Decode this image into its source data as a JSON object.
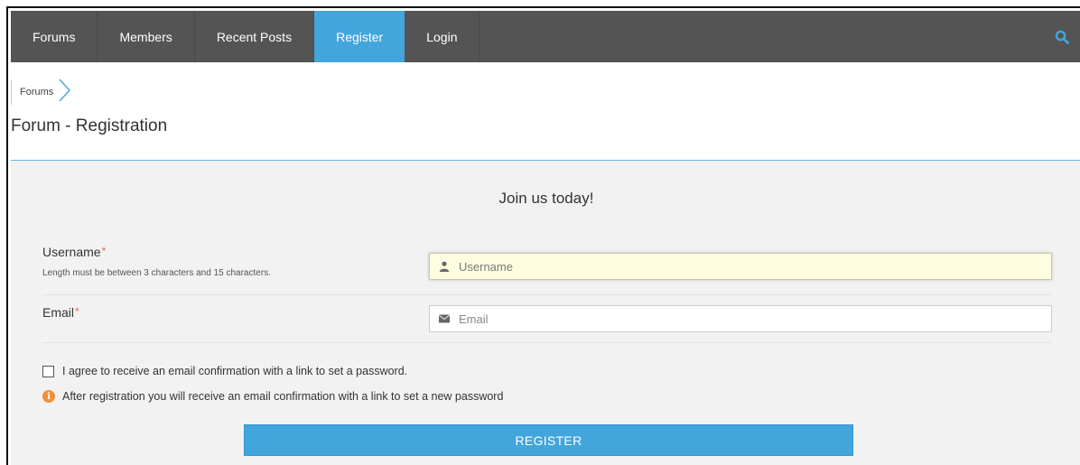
{
  "nav": {
    "items": [
      {
        "label": "Forums"
      },
      {
        "label": "Members"
      },
      {
        "label": "Recent Posts"
      },
      {
        "label": "Register"
      },
      {
        "label": "Login"
      }
    ],
    "active_index": 3,
    "search_icon": "search-icon"
  },
  "breadcrumb": {
    "items": [
      {
        "label": "Forums"
      }
    ]
  },
  "page": {
    "title": "Forum - Registration"
  },
  "form": {
    "heading": "Join us today!",
    "required_marker": "*",
    "username": {
      "label": "Username",
      "hint": "Length must be between 3 characters and 15 characters.",
      "placeholder": "Username",
      "value": "",
      "icon": "user-icon"
    },
    "email": {
      "label": "Email",
      "placeholder": "Email",
      "value": "",
      "icon": "envelope-icon"
    },
    "agree_label": "I agree to receive an email confirmation with a link to set a password.",
    "agree_checked": false,
    "info_text": "After registration you will receive an email confirmation with a link to set a new password",
    "register_label": "REGISTER"
  },
  "colors": {
    "nav_bg": "#545454",
    "accent": "#42a5dc",
    "required": "#e5685a",
    "info": "#f0903c",
    "panel_bg": "#f2f2f2",
    "focused_field": "#fefde0"
  }
}
